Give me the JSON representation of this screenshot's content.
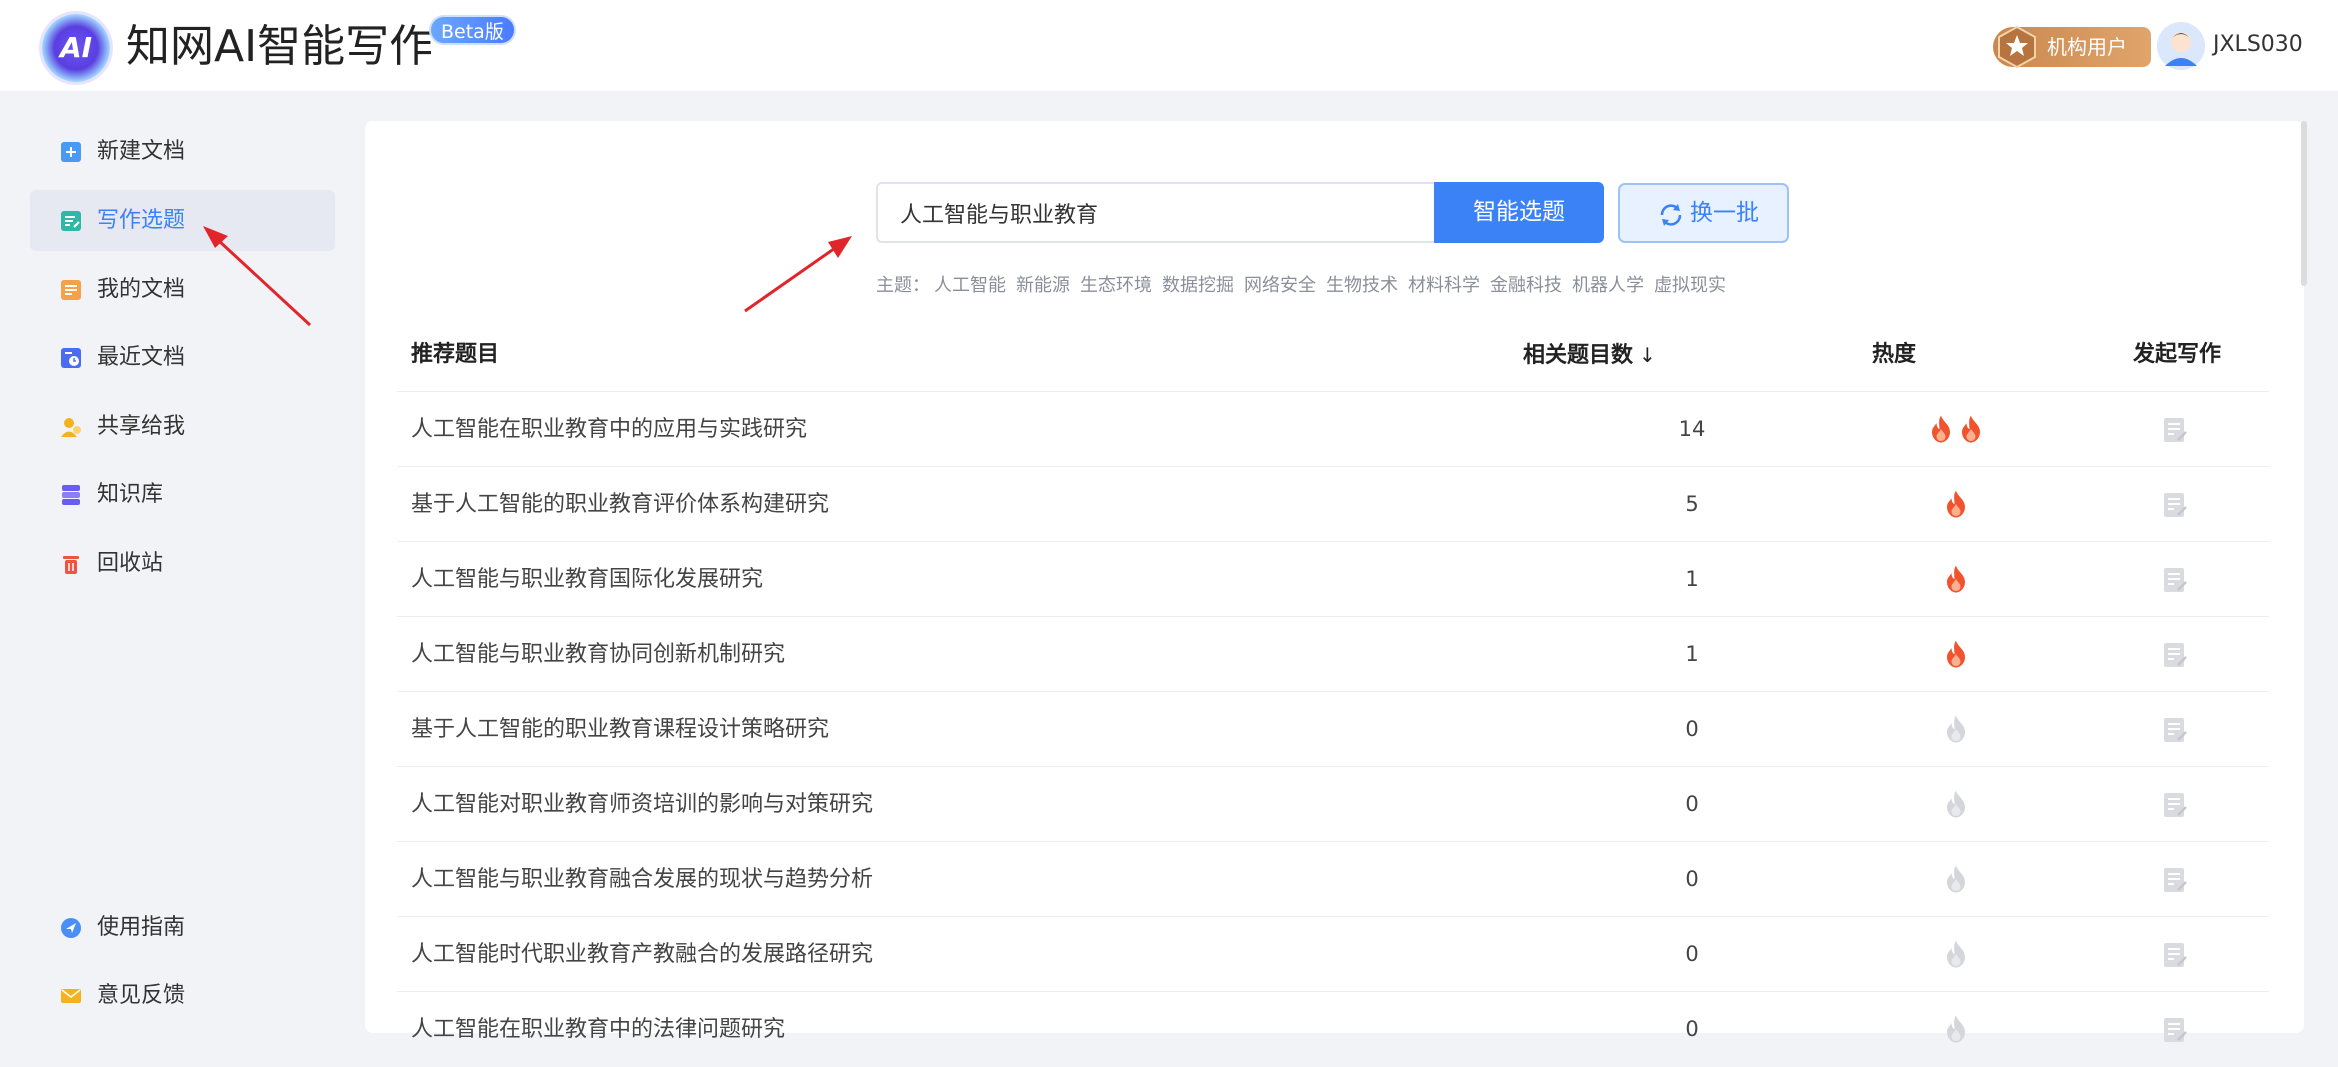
{
  "header": {
    "logo_text": "AI",
    "app_title": "知网AI智能写作",
    "beta_label": "Beta版",
    "org_badge": "机构用户",
    "username": "JXLS030"
  },
  "sidebar": {
    "items": [
      {
        "label": "新建文档",
        "icon": "new-doc-icon",
        "active": false
      },
      {
        "label": "写作选题",
        "icon": "topic-icon",
        "active": true
      },
      {
        "label": "我的文档",
        "icon": "my-docs-icon",
        "active": false
      },
      {
        "label": "最近文档",
        "icon": "recent-docs-icon",
        "active": false
      },
      {
        "label": "共享给我",
        "icon": "shared-icon",
        "active": false
      },
      {
        "label": "知识库",
        "icon": "knowledge-base-icon",
        "active": false
      },
      {
        "label": "回收站",
        "icon": "trash-icon",
        "active": false
      }
    ],
    "bottom_items": [
      {
        "label": "使用指南",
        "icon": "guide-icon"
      },
      {
        "label": "意见反馈",
        "icon": "feedback-icon"
      }
    ]
  },
  "search": {
    "value": "人工智能与职业教育",
    "button_label": "智能选题",
    "refresh_label": "换一批"
  },
  "topics": {
    "label": "主题：",
    "items": [
      "人工智能",
      "新能源",
      "生态环境",
      "数据挖掘",
      "网络安全",
      "生物技术",
      "材料科学",
      "金融科技",
      "机器人学",
      "虚拟现实"
    ]
  },
  "table": {
    "columns": {
      "title": "推荐题目",
      "count": "相关题目数",
      "count_sort": "↓",
      "heat": "热度",
      "write": "发起写作"
    },
    "rows": [
      {
        "title": "人工智能在职业教育中的应用与实践研究",
        "count": "14",
        "heat": 2
      },
      {
        "title": "基于人工智能的职业教育评价体系构建研究",
        "count": "5",
        "heat": 1
      },
      {
        "title": "人工智能与职业教育国际化发展研究",
        "count": "1",
        "heat": 1
      },
      {
        "title": "人工智能与职业教育协同创新机制研究",
        "count": "1",
        "heat": 1
      },
      {
        "title": "基于人工智能的职业教育课程设计策略研究",
        "count": "0",
        "heat": 0
      },
      {
        "title": "人工智能对职业教育师资培训的影响与对策研究",
        "count": "0",
        "heat": 0
      },
      {
        "title": "人工智能与职业教育融合发展的现状与趋势分析",
        "count": "0",
        "heat": 0
      },
      {
        "title": "人工智能时代职业教育产教融合的发展路径研究",
        "count": "0",
        "heat": 0
      },
      {
        "title": "人工智能在职业教育中的法律问题研究",
        "count": "0",
        "heat": 0
      }
    ]
  },
  "colors": {
    "accent": "#3b82f6",
    "flame_hot": "#f0532e",
    "flame_cold": "#d4d6db",
    "arrow": "#e0262b"
  }
}
